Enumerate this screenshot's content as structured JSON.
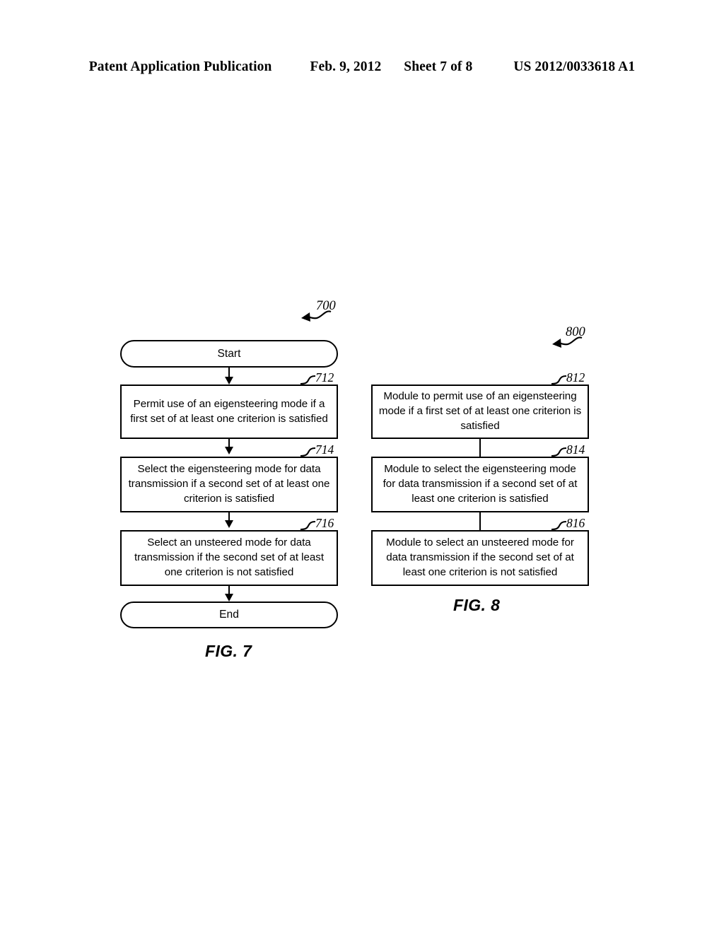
{
  "header": {
    "publication": "Patent Application Publication",
    "date": "Feb. 9, 2012",
    "sheet": "Sheet 7 of 8",
    "docnum": "US 2012/0033618 A1"
  },
  "figures": [
    {
      "id": "fig7",
      "caption": "FIG. 7",
      "callout": "700",
      "nodes": [
        {
          "ref": "",
          "kind": "terminator",
          "text": "Start"
        },
        {
          "ref": "712",
          "kind": "process",
          "text": "Permit use of an eigensteering mode if a first set of at least one criterion is satisfied"
        },
        {
          "ref": "714",
          "kind": "process",
          "text": "Select the eigensteering mode for data transmission if a second set of at least one criterion is satisfied"
        },
        {
          "ref": "716",
          "kind": "process",
          "text": "Select an unsteered mode for data transmission if the second set of at least one criterion is not satisfied"
        },
        {
          "ref": "",
          "kind": "terminator",
          "text": "End"
        }
      ]
    },
    {
      "id": "fig8",
      "caption": "FIG. 8",
      "callout": "800",
      "nodes": [
        {
          "ref": "812",
          "kind": "process",
          "text": "Module to permit use of an eigensteering mode if a first set of at least one criterion is satisfied"
        },
        {
          "ref": "814",
          "kind": "process",
          "text": "Module to select the eigensteering mode for data transmission if a second set of at least one criterion is satisfied"
        },
        {
          "ref": "816",
          "kind": "process",
          "text": "Module to select an unsteered mode for data transmission if the second set of at least one criterion is not satisfied"
        }
      ]
    }
  ]
}
